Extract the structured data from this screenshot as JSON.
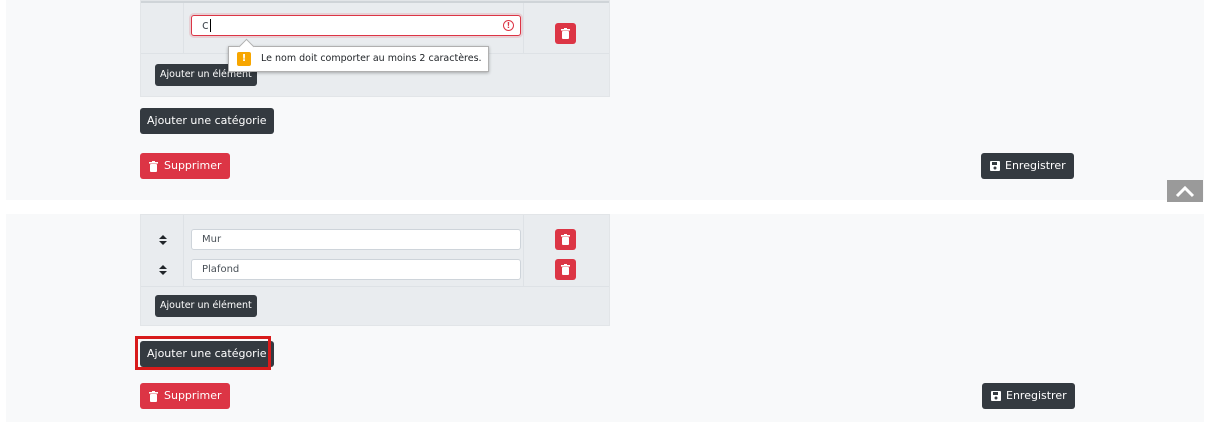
{
  "top_panel": {
    "input_value": "c",
    "tooltip_message": "Le nom doit comporter au moins 2 caractères.",
    "add_element_label": "Ajouter un élément",
    "add_category_label": "Ajouter une catégorie",
    "delete_label": "Supprimer",
    "save_label": "Enregistrer"
  },
  "bottom_panel": {
    "items": [
      {
        "name": "Mur"
      },
      {
        "name": "Plafond"
      }
    ],
    "add_element_label": "Ajouter un élément",
    "add_category_label": "Ajouter une catégorie",
    "delete_label": "Supprimer",
    "save_label": "Enregistrer"
  },
  "icons": {
    "trash": "trash-icon",
    "save": "floppy-disk-icon",
    "sort": "sort-icon",
    "warning": "warning-icon",
    "error": "exclamation-circle-icon",
    "scroll_top": "chevron-up-icon"
  },
  "colors": {
    "danger": "#dc3545",
    "dark": "#343a40",
    "warning": "#f7a600",
    "highlight": "#d81b1b"
  }
}
